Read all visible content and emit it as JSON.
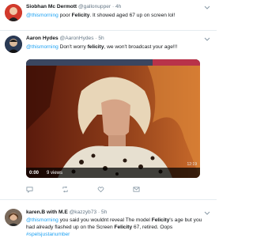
{
  "tweets": [
    {
      "name": "Siobhan Mc Dermott",
      "handle": "@gallonupper",
      "time": "· 4h",
      "mention": "@thismorning",
      "text_before": " poor ",
      "bold": "Felicity",
      "text_after": ". It showed aged 67 up on screen lol!"
    },
    {
      "name": "Aaron Hydes",
      "handle": "@AaronHydes",
      "time": "· 5h",
      "mention": "@thismorning",
      "text_before": " Don't worry ",
      "bold": "felicity",
      "text_after": ", we won't broadcast your age!!!"
    },
    {
      "name": "karen.B with M.E",
      "handle": "@kazzyb73",
      "time": "· 5h",
      "mention": "@thismorning",
      "text_before": " you said you wouldnt reveal The model ",
      "bold": "Felicity",
      "text_mid": "'s age but you had already flashed up on the Screen ",
      "bold2": "Felicity",
      "text_after": " 67, retired. Oops",
      "hashtag": "#spelsjustanumber"
    }
  ],
  "video": {
    "timestamp": "0:00",
    "views": "9 views",
    "clock": "12:19"
  },
  "icons": [
    "reply-icon",
    "retweet-icon",
    "like-icon",
    "message-icon",
    "chevron-down-icon"
  ],
  "colors": {
    "link": "#1da1f2",
    "handle": "#657786",
    "border": "#e6ecf0"
  }
}
